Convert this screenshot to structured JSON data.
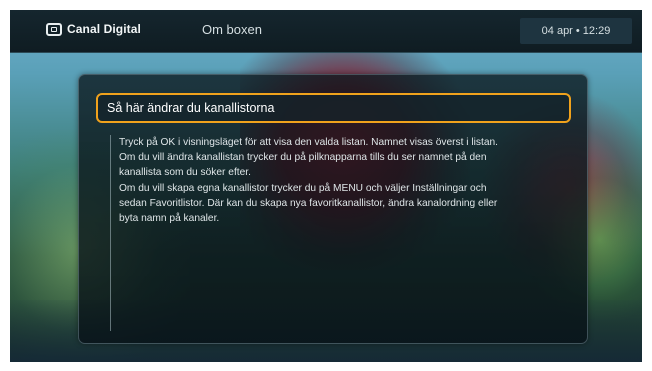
{
  "topbar": {
    "brand": "Canal Digital",
    "brand_icon": "tv-icon",
    "section_title": "Om boxen",
    "datetime": "04 apr • 12:29"
  },
  "dialog": {
    "heading": "Så här ändrar du kanallistorna",
    "body_lines": [
      "Tryck på OK i visningsläget för att visa den valda listan. Namnet visas överst i listan.",
      "Om du vill ändra kanallistan trycker du på pilknapparna tills du ser namnet på den",
      "kanallista som du söker efter.",
      "Om du vill skapa egna kanallistor trycker du på MENU och väljer Inställningar och",
      "sedan Favoritlistor. Där kan du skapa nya favoritkanallistor, ändra kanalordning eller",
      "byta namn på kanaler."
    ]
  },
  "colors": {
    "highlight": "#f0a21c",
    "topbar_bg": "#15262e",
    "panel_bg": "#0c181e"
  }
}
